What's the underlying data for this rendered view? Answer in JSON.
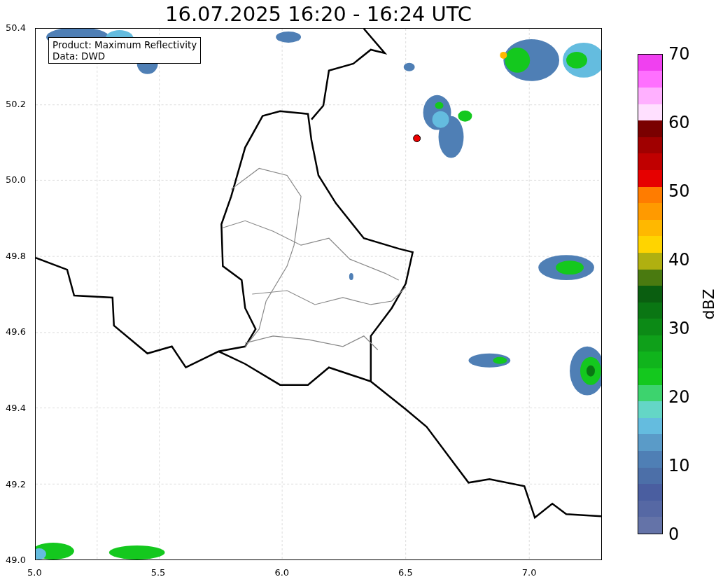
{
  "title": "16.07.2025 16:20 - 16:24 UTC",
  "info_box": [
    "Product: Maximum Reflectivity",
    "Data: DWD"
  ],
  "x_ticks": [
    "5.0",
    "5.5",
    "6.0",
    "6.5",
    "7.0"
  ],
  "y_ticks": [
    "50.4",
    "50.2",
    "50.0",
    "49.8",
    "49.6",
    "49.4",
    "49.2",
    "49.0"
  ],
  "colorbar": {
    "label": "dBZ",
    "ticks": [
      "70",
      "60",
      "50",
      "40",
      "30",
      "20",
      "10",
      "0"
    ],
    "segments": [
      {
        "color": "#6473a8"
      },
      {
        "color": "#5668a4"
      },
      {
        "color": "#4a5ea0"
      },
      {
        "color": "#4c6fa8"
      },
      {
        "color": "#4f7fb5"
      },
      {
        "color": "#5a9bc8"
      },
      {
        "color": "#64bcdf"
      },
      {
        "color": "#64d6c6"
      },
      {
        "color": "#3dd36e"
      },
      {
        "color": "#14c81e"
      },
      {
        "color": "#10b41c"
      },
      {
        "color": "#0fa01a"
      },
      {
        "color": "#0c8a16"
      },
      {
        "color": "#0a7613"
      },
      {
        "color": "#0a5e10"
      },
      {
        "color": "#4a7a10"
      },
      {
        "color": "#b0b010"
      },
      {
        "color": "#ffd400"
      },
      {
        "color": "#ffb800"
      },
      {
        "color": "#ff9a00"
      },
      {
        "color": "#ff7c00"
      },
      {
        "color": "#e60000"
      },
      {
        "color": "#c00000"
      },
      {
        "color": "#a00000"
      },
      {
        "color": "#7a0000"
      },
      {
        "color": "#ffe0ff"
      },
      {
        "color": "#ffb0ff"
      },
      {
        "color": "#ff70ff"
      },
      {
        "color": "#f040f0"
      }
    ]
  }
}
